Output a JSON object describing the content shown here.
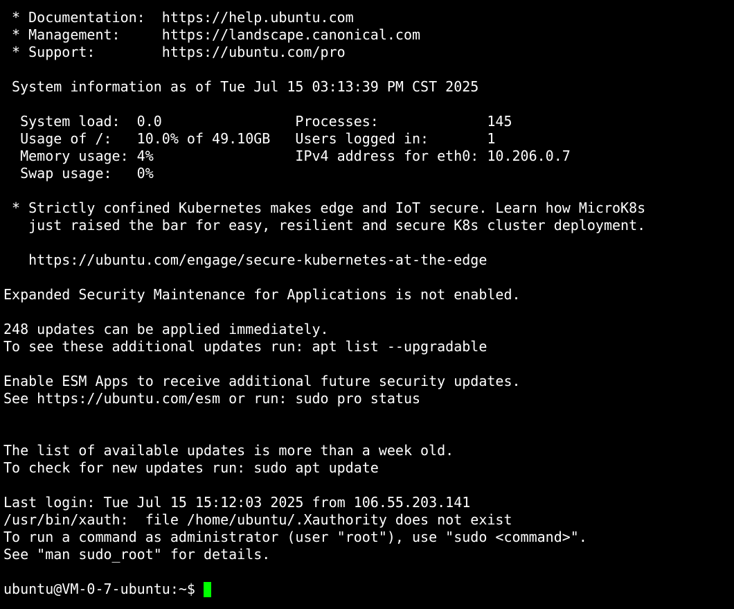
{
  "terminal": {
    "lines": [
      " * Documentation:  https://help.ubuntu.com",
      " * Management:     https://landscape.canonical.com",
      " * Support:        https://ubuntu.com/pro",
      "",
      " System information as of Tue Jul 15 03:13:39 PM CST 2025",
      "",
      "  System load:  0.0                Processes:             145",
      "  Usage of /:   10.0% of 49.10GB   Users logged in:       1",
      "  Memory usage: 4%                 IPv4 address for eth0: 10.206.0.7",
      "  Swap usage:   0%",
      "",
      " * Strictly confined Kubernetes makes edge and IoT secure. Learn how MicroK8s",
      "   just raised the bar for easy, resilient and secure K8s cluster deployment.",
      "",
      "   https://ubuntu.com/engage/secure-kubernetes-at-the-edge",
      "",
      "Expanded Security Maintenance for Applications is not enabled.",
      "",
      "248 updates can be applied immediately.",
      "To see these additional updates run: apt list --upgradable",
      "",
      "Enable ESM Apps to receive additional future security updates.",
      "See https://ubuntu.com/esm or run: sudo pro status",
      "",
      "",
      "The list of available updates is more than a week old.",
      "To check for new updates run: sudo apt update",
      "",
      "Last login: Tue Jul 15 15:12:03 2025 from 106.55.203.141",
      "/usr/bin/xauth:  file /home/ubuntu/.Xauthority does not exist",
      "To run a command as administrator (user \"root\"), use \"sudo <command>\".",
      "See \"man sudo_root\" for details.",
      ""
    ],
    "prompt": "ubuntu@VM-0-7-ubuntu:~$",
    "colors": {
      "background": "#000000",
      "foreground": "#ffffff",
      "cursor": "#00ff00"
    }
  }
}
